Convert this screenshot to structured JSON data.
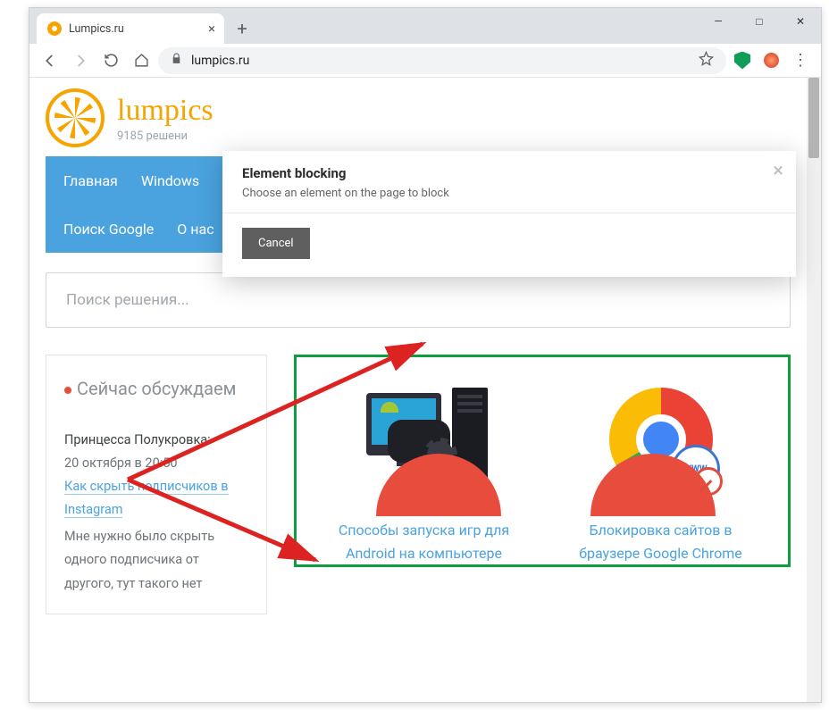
{
  "browser": {
    "tab_title": "Lumpics.ru",
    "url_display": "lumpics.ru",
    "new_tab_glyph": "+",
    "close_tab_glyph": "×",
    "win_minimize": "—",
    "win_maximize": "□",
    "win_close": "✕"
  },
  "dialog": {
    "title": "Element blocking",
    "subtitle": "Choose an element on the page to block",
    "cancel": "Cancel",
    "close_glyph": "×"
  },
  "site": {
    "title": "lumpics",
    "subtitle": "9185 решени",
    "nav_row1": [
      "Главная",
      "Windows"
    ],
    "nav_row2": [
      "Поиск Google",
      "О нас"
    ],
    "search_placeholder": "Поиск решения..."
  },
  "sidebar": {
    "heading": "Сейчас обсуждаем",
    "author_line": "Принцесса Полукровка:",
    "date_line": "20 октября в 20:50",
    "link_text": "Как скрыть подписчиков в Instagram",
    "comment": "Мне нужно было скрыть одного подписчика от другого, тут такого нет"
  },
  "articles": [
    {
      "title": "Способы запуска игр для Android на компьютере"
    },
    {
      "title": "Блокировка сайтов в браузере Google Chrome",
      "badge": "WWW"
    }
  ]
}
